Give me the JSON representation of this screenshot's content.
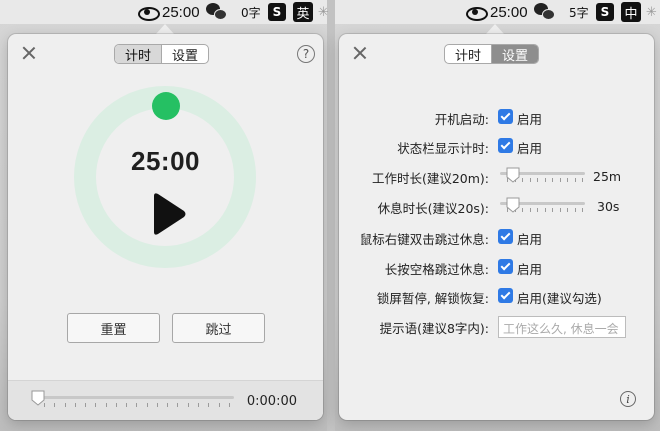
{
  "menubar_left": {
    "timer": "25:00",
    "char_count": "0字",
    "sogou": "S",
    "ime": "英"
  },
  "menubar_right": {
    "timer": "25:00",
    "char_count": "5字",
    "sogou": "S",
    "ime": "中"
  },
  "timer_panel": {
    "tabs": [
      "计时",
      "设置"
    ],
    "selected_tab": "计时",
    "help": "?",
    "time": "25:00",
    "reset_label": "重置",
    "skip_label": "跳过",
    "elapsed": "0:00:00",
    "elapsed_progress": 0,
    "ring_color": "#25c063"
  },
  "settings_panel": {
    "tabs": [
      "计时",
      "设置"
    ],
    "selected_tab": "设置",
    "rows": {
      "autostart": {
        "label": "开机启动:",
        "checked": true,
        "option": "启用"
      },
      "statusbar": {
        "label": "状态栏显示计时:",
        "checked": true,
        "option": "启用"
      },
      "work": {
        "label": "工作时长(建议20m):",
        "value": "25m"
      },
      "rest": {
        "label": "休息时长(建议20s):",
        "value": "30s"
      },
      "rightclick": {
        "label": "鼠标右键双击跳过休息:",
        "checked": true,
        "option": "启用"
      },
      "space": {
        "label": "长按空格跳过休息:",
        "checked": true,
        "option": "启用"
      },
      "lock": {
        "label": "锁屏暂停, 解锁恢复:",
        "checked": true,
        "option": "启用(建议勾选)"
      },
      "tip": {
        "label": "提示语(建议8字内):",
        "placeholder": "工作这么久, 休息一会"
      }
    },
    "info": "i"
  }
}
